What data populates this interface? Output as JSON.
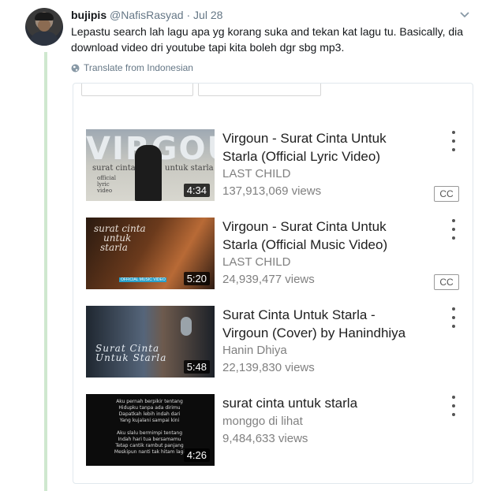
{
  "tweet": {
    "display_name": "bujipis",
    "handle": "@NafisRasyad",
    "separator": "·",
    "date": "Jul 28",
    "text": "Lepastu search lah lagu apa yg korang suka and tekan kat lagu tu. Basically, dia download video dri youtube tapi kita boleh dgr sbg mp3.",
    "translate_label": "Translate from Indonesian"
  },
  "icons": {
    "avatar": "user-avatar",
    "caret": "chevron-down-icon",
    "globe": "globe-icon",
    "menu": "more-vertical-icon"
  },
  "colors": {
    "thread_line": "#cfe8cf",
    "muted_text": "#657786",
    "card_border": "#e1e8ed"
  },
  "videos": [
    {
      "title": "Virgoun - Surat Cinta Untuk Starla (Official Lyric Video)",
      "channel": "LAST CHILD",
      "views": "137,913,069 views",
      "duration": "4:34",
      "badge": "CC",
      "thumb_text": [
        "VIRGOUN",
        "surat cinta",
        "untuk starla",
        "official lyric video"
      ]
    },
    {
      "title": "Virgoun - Surat Cinta Untuk Starla (Official Music Video)",
      "channel": "LAST CHILD",
      "views": "24,939,477 views",
      "duration": "5:20",
      "badge": "CC",
      "thumb_text": [
        "surat cinta",
        "untuk",
        "starla",
        "OFFICIAL MUSIC VIDEO"
      ]
    },
    {
      "title": "Surat Cinta Untuk Starla - Virgoun (Cover) by Hanindhiya",
      "channel": "Hanin Dhiya",
      "views": "22,139,830 views",
      "duration": "5:48",
      "thumb_text": [
        "Surat Cinta",
        "Untuk Starla"
      ]
    },
    {
      "title": "surat cinta untuk starla",
      "channel": "monggo di lihat",
      "views": "9,484,633 views",
      "duration": "4:26",
      "thumb_text": [
        "Aku pernah berpikir tentang",
        "Hidupku tanpa ada dirimu",
        "Dapatkah lebih indah dari",
        "Yang kujalani sampai kini",
        "Aku slalu bermimpi tentang",
        "Indah hari tua bersamamu",
        "Tetap cantik rambut panjang",
        "Meskipun nanti tak hitam lagi"
      ]
    }
  ]
}
